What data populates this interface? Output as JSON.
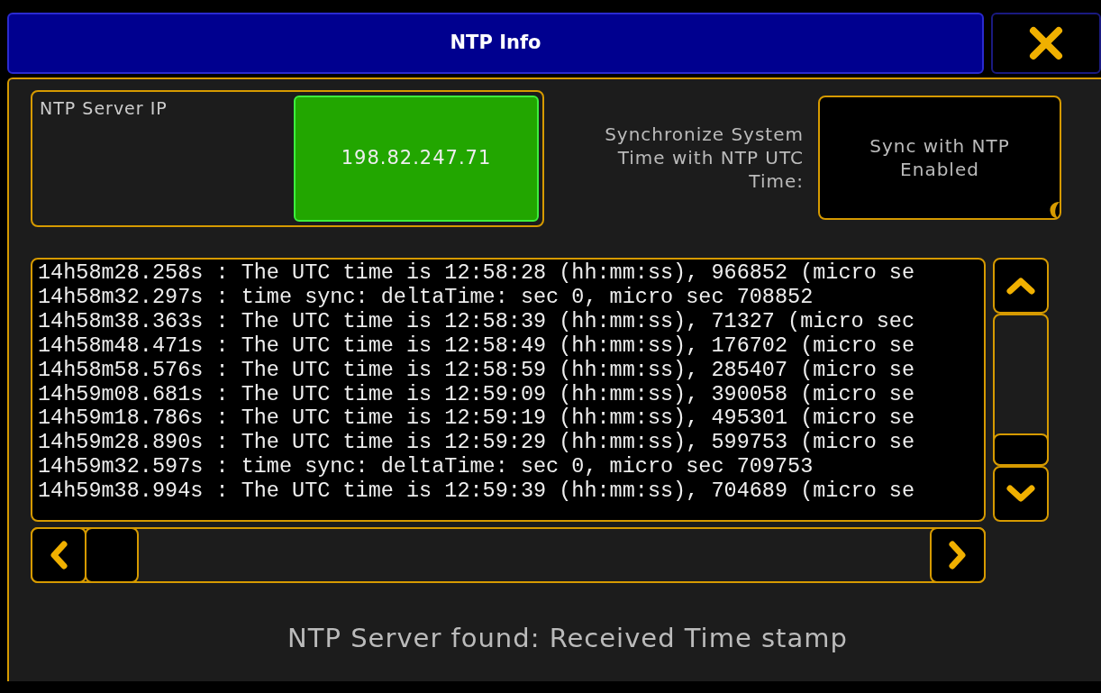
{
  "window": {
    "title": "NTP Info"
  },
  "server": {
    "label": "NTP Server IP",
    "value": "198.82.247.71"
  },
  "sync": {
    "label": "Synchronize System Time with NTP UTC Time:",
    "button": "Sync with NTP Enabled"
  },
  "log": {
    "lines": [
      "14h58m28.258s : The UTC time is 12:58:28 (hh:mm:ss), 966852 (micro se",
      "14h58m32.297s : time sync: deltaTime: sec 0, micro sec 708852",
      "14h58m38.363s : The UTC time is 12:58:39 (hh:mm:ss), 71327 (micro sec",
      "14h58m48.471s : The UTC time is 12:58:49 (hh:mm:ss), 176702 (micro se",
      "14h58m58.576s : The UTC time is 12:58:59 (hh:mm:ss), 285407 (micro se",
      "14h59m08.681s : The UTC time is 12:59:09 (hh:mm:ss), 390058 (micro se",
      "14h59m18.786s : The UTC time is 12:59:19 (hh:mm:ss), 495301 (micro se",
      "14h59m28.890s : The UTC time is 12:59:29 (hh:mm:ss), 599753 (micro se",
      "14h59m32.597s : time sync: deltaTime: sec 0, micro sec 709753",
      "14h59m38.994s : The UTC time is 12:59:39 (hh:mm:ss), 704689 (micro se"
    ]
  },
  "status": "NTP Server found: Received Time stamp"
}
